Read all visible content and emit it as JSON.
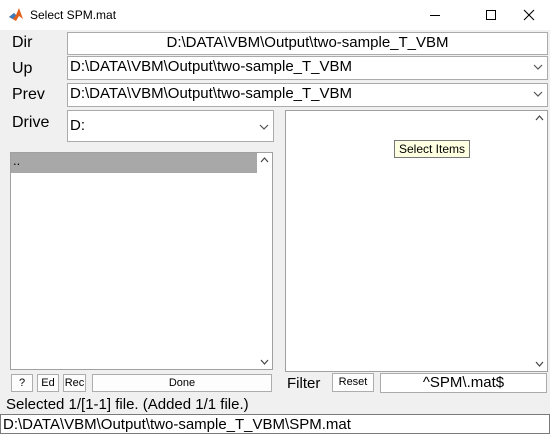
{
  "window": {
    "title": "Select SPM.mat",
    "minimize_icon": "minimize-icon",
    "maximize_icon": "maximize-icon",
    "close_icon": "close-icon"
  },
  "dir": {
    "label": "Dir",
    "value": "D:\\DATA\\VBM\\Output\\two-sample_T_VBM"
  },
  "up": {
    "label": "Up",
    "value": "D:\\DATA\\VBM\\Output\\two-sample_T_VBM"
  },
  "prev": {
    "label": "Prev",
    "value": "D:\\DATA\\VBM\\Output\\two-sample_T_VBM"
  },
  "drive": {
    "label": "Drive",
    "value": "D:"
  },
  "dir_list": {
    "items": [
      ".."
    ],
    "selected_index": 0
  },
  "buttons": {
    "help": "?",
    "edit": "Ed",
    "rec": "Rec",
    "done": "Done",
    "reset": "Reset"
  },
  "selected_items": {
    "tooltip": "Select Items"
  },
  "filter": {
    "label": "Filter",
    "value": "^SPM\\.mat$"
  },
  "status": "Selected 1/[1-1] file. (Added 1/1 file.)",
  "selected_path": "D:\\DATA\\VBM\\Output\\two-sample_T_VBM\\SPM.mat",
  "colors": {
    "selected_row": "#a8a8a8",
    "tooltip_bg": "#ffffe1"
  }
}
